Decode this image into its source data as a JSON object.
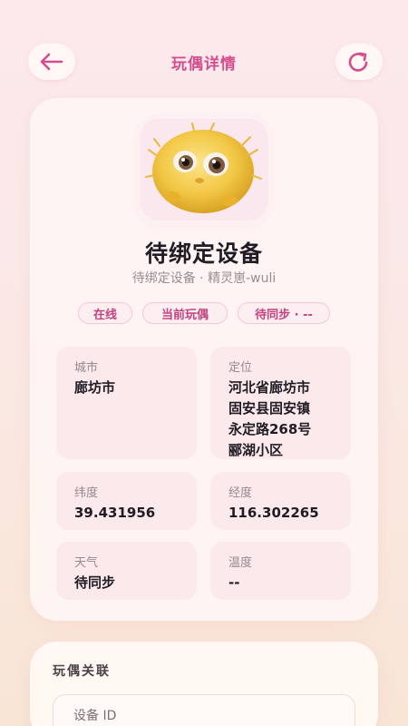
{
  "header": {
    "title": "玩偶详情",
    "back_icon": "arrow-left-icon",
    "refresh_icon": "refresh-icon",
    "accent_color": "#d44d8f"
  },
  "device": {
    "name": "待绑定设备",
    "subtitle": "待绑定设备 · 精灵崽-wuli",
    "avatar_icon": "fluffy-toy-avatar"
  },
  "chips": {
    "online": "在线",
    "current": "当前玩偶",
    "sync": "待同步 · --"
  },
  "info": {
    "city_label": "城市",
    "city_value": "廊坊市",
    "location_label": "定位",
    "location_line1": "河北省廊坊市",
    "location_line2": "固安县固安镇",
    "location_line3": "永定路268号",
    "location_line4": "郦湖小区",
    "latitude_label": "纬度",
    "latitude_value": "39.431956",
    "longitude_label": "经度",
    "longitude_value": "116.302265",
    "weather_label": "天气",
    "weather_value": "待同步",
    "temperature_label": "温度",
    "temperature_value": "--"
  },
  "association": {
    "title": "玩偶关联",
    "device_id_label": "设备 ID"
  }
}
